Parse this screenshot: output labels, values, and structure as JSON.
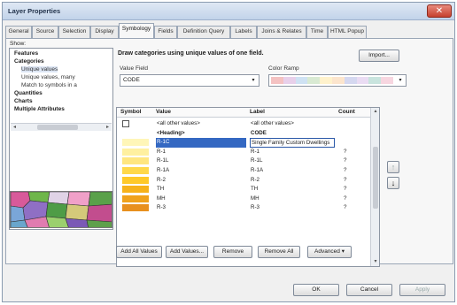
{
  "window": {
    "title": "Layer Properties",
    "close_glyph": "✕"
  },
  "tabs": [
    {
      "label": "General"
    },
    {
      "label": "Source"
    },
    {
      "label": "Selection"
    },
    {
      "label": "Display"
    },
    {
      "label": "Symbology"
    },
    {
      "label": "Fields"
    },
    {
      "label": "Definition Query"
    },
    {
      "label": "Labels"
    },
    {
      "label": "Joins & Relates"
    },
    {
      "label": "Time"
    },
    {
      "label": "HTML Popup"
    }
  ],
  "active_tab": "Symbology",
  "show_panel": {
    "label": "Show:",
    "items": [
      {
        "label": "Features",
        "bold": true
      },
      {
        "label": "Categories",
        "bold": true
      },
      {
        "label": "Unique values",
        "bold": false
      },
      {
        "label": "Unique values, many",
        "bold": false
      },
      {
        "label": "Match to symbols in a",
        "bold": false
      },
      {
        "label": "Quantities",
        "bold": true
      },
      {
        "label": "Charts",
        "bold": true
      },
      {
        "label": "Multiple Attributes",
        "bold": true
      }
    ],
    "scroll_left": "◂",
    "scroll_right": "▸",
    "map_preview_icon": "state-map-preview-icon"
  },
  "symbology": {
    "heading": "Draw categories using unique values of one field.",
    "import_label": "Import...",
    "value_field_label": "Value Field",
    "value_field_value": "CODE",
    "color_ramp_label": "Color Ramp",
    "dropdown_glyph": "▾",
    "color_ramp_colors": [
      "#f4c2c2",
      "#e8d0ea",
      "#cfe2f3",
      "#d9ead3",
      "#fff2cc",
      "#fce5cd",
      "#d5d8f0",
      "#eadcf3",
      "#c9e4de",
      "#f7d6e0"
    ]
  },
  "grid": {
    "columns": [
      "Symbol",
      "Value",
      "Label",
      "Count"
    ],
    "rows": [
      {
        "kind": "check",
        "value": "<all other values>",
        "label": "<all other values>",
        "count": "",
        "swatch": "",
        "bold": false,
        "selected": false
      },
      {
        "kind": "heading",
        "value": "<Heading>",
        "label": "CODE",
        "count": "",
        "swatch": "",
        "bold": true,
        "selected": false
      },
      {
        "kind": "swatch",
        "value": "R-1C",
        "label": "Single Family Custom Dwellings",
        "count": "",
        "swatch": "#fff6b8",
        "bold": false,
        "selected": true
      },
      {
        "kind": "swatch",
        "value": "R-1",
        "label": "R-1",
        "count": "?",
        "swatch": "#fff0a0",
        "bold": false,
        "selected": false
      },
      {
        "kind": "swatch",
        "value": "R-1L",
        "label": "R-1L",
        "count": "?",
        "swatch": "#ffe680",
        "bold": false,
        "selected": false
      },
      {
        "kind": "swatch",
        "value": "R-1A",
        "label": "R-1A",
        "count": "?",
        "swatch": "#ffd84a",
        "bold": false,
        "selected": false
      },
      {
        "kind": "swatch",
        "value": "R-2",
        "label": "R-2",
        "count": "?",
        "swatch": "#ffc928",
        "bold": false,
        "selected": false
      },
      {
        "kind": "swatch",
        "value": "TH",
        "label": "TH",
        "count": "?",
        "swatch": "#f7b21a",
        "bold": false,
        "selected": false
      },
      {
        "kind": "swatch",
        "value": "MH",
        "label": "MH",
        "count": "?",
        "swatch": "#f0a21c",
        "bold": false,
        "selected": false
      },
      {
        "kind": "swatch",
        "value": "R-3",
        "label": "R-3",
        "count": "?",
        "swatch": "#e8901e",
        "bold": false,
        "selected": false
      }
    ],
    "scroll_up": "▴",
    "scroll_down": "▾"
  },
  "side_buttons": {
    "up_glyph": "↑",
    "down_glyph": "↓"
  },
  "bottom_buttons": {
    "add_all_values": "Add All Values",
    "add_values": "Add Values...",
    "remove": "Remove",
    "remove_all": "Remove All",
    "advanced": "Advanced ▾"
  },
  "dialog_buttons": {
    "ok": "OK",
    "cancel": "Cancel",
    "apply": "Apply"
  }
}
